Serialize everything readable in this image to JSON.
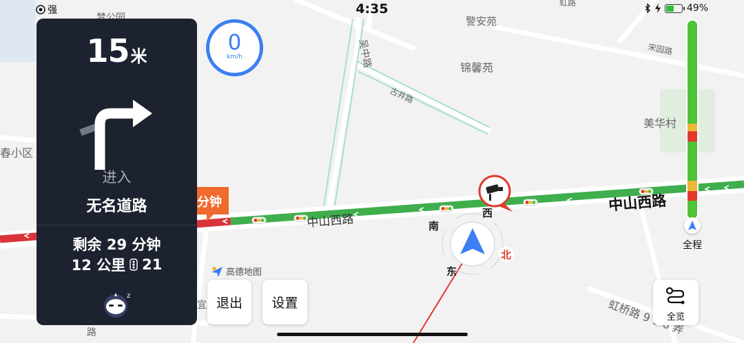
{
  "status_bar": {
    "signal_label": "强",
    "time": "4:35",
    "battery_percent": 49,
    "battery_label": "49%"
  },
  "guidance": {
    "distance": "15",
    "distance_unit": "米",
    "turn_direction": "right",
    "action": "进入",
    "road_name": "无名道路",
    "remaining_time": "剩余 29 分钟",
    "remaining_distance": "12 公里",
    "traffic_lights": "21"
  },
  "speed": {
    "value": "0",
    "unit": "km/h"
  },
  "map_labels": {
    "poi_top_left": "梦公园",
    "poi_jingan": "警安苑",
    "poi_jinxin": "锦馨苑",
    "poi_meihua": "美华村",
    "poi_chun": "春小区",
    "road_wuzhong": "吴中路",
    "road_gujing": "古井路",
    "road_songyuan": "宋园路",
    "road_zhongshan_west": "中山西路",
    "road_zhongshan_main": "中山西路",
    "road_hongqiao": "虹桥路 9 9 6 弄",
    "road_bottom_left": "路",
    "road_xinghao": "路",
    "road_top_right": "虹路",
    "road_left_end": "宜路",
    "timing_tag": "分钟"
  },
  "compass": {
    "south": "南",
    "west": "西",
    "east": "东",
    "north": "北"
  },
  "route_progress": {
    "label": "全程",
    "segments": [
      {
        "status": "smooth",
        "start": 0.0,
        "end": 0.52
      },
      {
        "status": "slow",
        "start": 0.52,
        "end": 0.56
      },
      {
        "status": "congested",
        "start": 0.56,
        "end": 0.61
      },
      {
        "status": "smooth",
        "start": 0.61,
        "end": 0.81
      },
      {
        "status": "slow",
        "start": 0.81,
        "end": 0.86
      },
      {
        "status": "congested",
        "start": 0.86,
        "end": 0.91
      },
      {
        "status": "smooth",
        "start": 0.91,
        "end": 1.0
      }
    ]
  },
  "buttons": {
    "exit": "退出",
    "settings": "设置",
    "overview": "全览"
  },
  "brand": {
    "logo_text": "高德地图"
  },
  "colors": {
    "smooth": "#4fc33a",
    "slow": "#f0b63a",
    "congested": "#e03a2e",
    "route_blue": "#3b7ff2",
    "panel_bg": "#1d2230"
  }
}
